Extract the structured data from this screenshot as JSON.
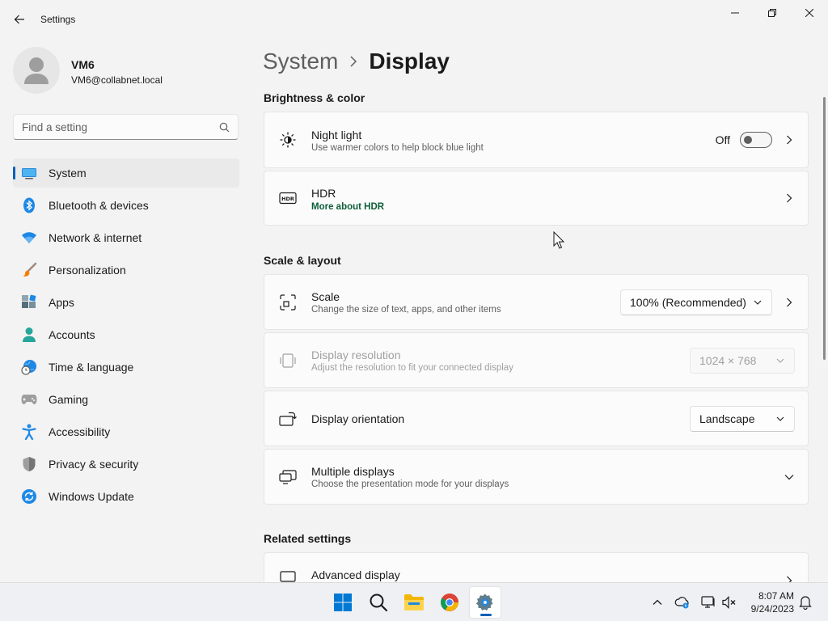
{
  "window": {
    "title": "Settings"
  },
  "user": {
    "name": "VM6",
    "email": "VM6@collabnet.local"
  },
  "search": {
    "placeholder": "Find a setting"
  },
  "nav": [
    {
      "label": "System",
      "icon": "laptop-icon",
      "active": true
    },
    {
      "label": "Bluetooth & devices",
      "icon": "bluetooth-icon"
    },
    {
      "label": "Network & internet",
      "icon": "wifi-icon"
    },
    {
      "label": "Personalization",
      "icon": "paintbrush-icon"
    },
    {
      "label": "Apps",
      "icon": "apps-icon"
    },
    {
      "label": "Accounts",
      "icon": "person-icon"
    },
    {
      "label": "Time & language",
      "icon": "globe-clock-icon"
    },
    {
      "label": "Gaming",
      "icon": "gamepad-icon"
    },
    {
      "label": "Accessibility",
      "icon": "accessibility-icon"
    },
    {
      "label": "Privacy & security",
      "icon": "shield-icon"
    },
    {
      "label": "Windows Update",
      "icon": "update-icon"
    }
  ],
  "breadcrumb": {
    "parent": "System",
    "current": "Display"
  },
  "sections": {
    "brightness": "Brightness & color",
    "scale_layout": "Scale & layout",
    "related": "Related settings"
  },
  "night_light": {
    "title": "Night light",
    "subtitle": "Use warmer colors to help block blue light",
    "state_label": "Off",
    "on": false
  },
  "hdr": {
    "title": "HDR",
    "link": "More about HDR"
  },
  "scale": {
    "title": "Scale",
    "subtitle": "Change the size of text, apps, and other items",
    "value": "100% (Recommended)"
  },
  "resolution": {
    "title": "Display resolution",
    "subtitle": "Adjust the resolution to fit your connected display",
    "value": "1024 × 768",
    "disabled": true
  },
  "orientation": {
    "title": "Display orientation",
    "value": "Landscape"
  },
  "multiple_displays": {
    "title": "Multiple displays",
    "subtitle": "Choose the presentation mode for your displays"
  },
  "advanced_display": {
    "title": "Advanced display"
  },
  "taskbar": {
    "time": "8:07 AM",
    "date": "9/24/2023"
  },
  "colors": {
    "accent": "#005fb8",
    "background": "#f3f3f3",
    "card": "#fbfbfb"
  }
}
